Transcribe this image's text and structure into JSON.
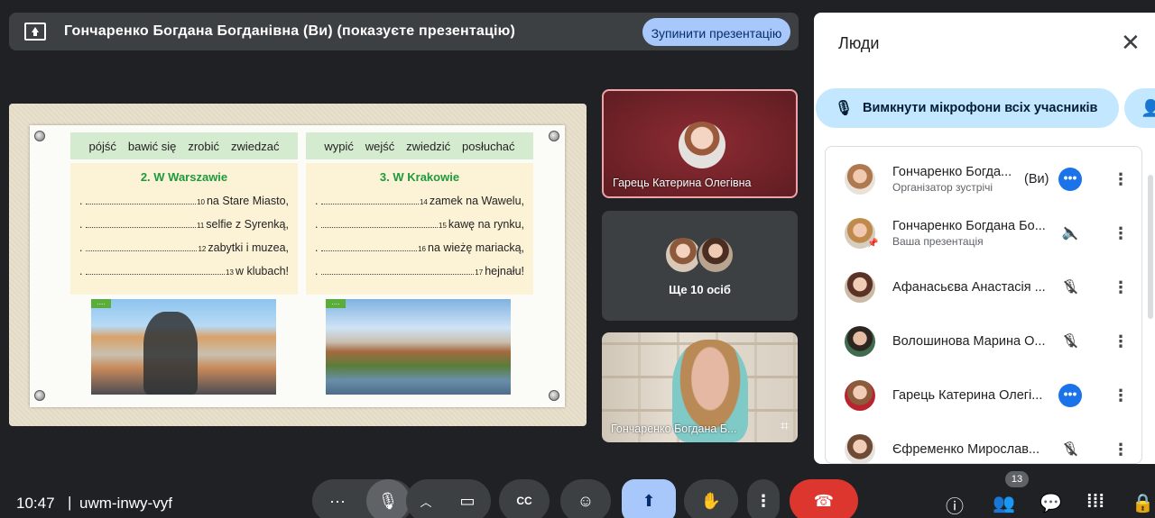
{
  "banner": {
    "text": "Гончаренко Богдана Богданівна (Ви) (показуєте презентацію)",
    "stop_label": "Зупинити презентацію"
  },
  "slide": {
    "verbs_left": [
      "pójść",
      "bawić się",
      "zrobić",
      "zwiedzać"
    ],
    "verbs_right": [
      "wypić",
      "wejść",
      "zwiedzić",
      "posłuchać"
    ],
    "task_left": {
      "title": "2. W Warszawie",
      "lines": [
        {
          "num": "10",
          "text": "na Stare Miasto,"
        },
        {
          "num": "11",
          "text": "selfie z Syrenką,"
        },
        {
          "num": "12",
          "text": "zabytki i muzea,"
        },
        {
          "num": "13",
          "text": "w klubach!"
        }
      ]
    },
    "task_right": {
      "title": "3. W Krakowie",
      "lines": [
        {
          "num": "14",
          "text": "zamek na Wawelu,"
        },
        {
          "num": "15",
          "text": "kawę na rynku,"
        },
        {
          "num": "16",
          "text": "na wieżę mariacką,"
        },
        {
          "num": "17",
          "text": "hejnału!"
        }
      ]
    },
    "photo_tag": "....",
    "dot": "."
  },
  "tiles": {
    "active_name": "Гарець Катерина Олегівна",
    "more_label": "Ще 10 осіб",
    "self_name": "Гончаренко Богдана Б..."
  },
  "panel": {
    "title": "Люди",
    "mute_all_label": "Вимкнути мікрофони всіх учасників",
    "you_label": "(Ви)",
    "people": [
      {
        "name": "Гончаренко Богда...",
        "sub": "Організатор зустрічі",
        "status": "active"
      },
      {
        "name": "Гончаренко Богдана Бо...",
        "sub": "Ваша презентація",
        "status": "muted-presentation"
      },
      {
        "name": "Афанасьєва Анастасія ...",
        "sub": "",
        "status": "mic-off"
      },
      {
        "name": "Волошинова Марина О...",
        "sub": "",
        "status": "mic-off"
      },
      {
        "name": "Гарець Катерина Олегі...",
        "sub": "",
        "status": "active"
      },
      {
        "name": "Єфременко Мирослав...",
        "sub": "",
        "status": "mic-off"
      }
    ]
  },
  "bottom": {
    "time": "10:47",
    "separator": "|",
    "meeting_code": "uwm-inwy-vyf",
    "people_count": "13",
    "cc_label": "CC"
  },
  "colors": {
    "accent": "#a8c7fa",
    "end_call": "#dc362e",
    "speaking_dot": "#1a73e8"
  }
}
